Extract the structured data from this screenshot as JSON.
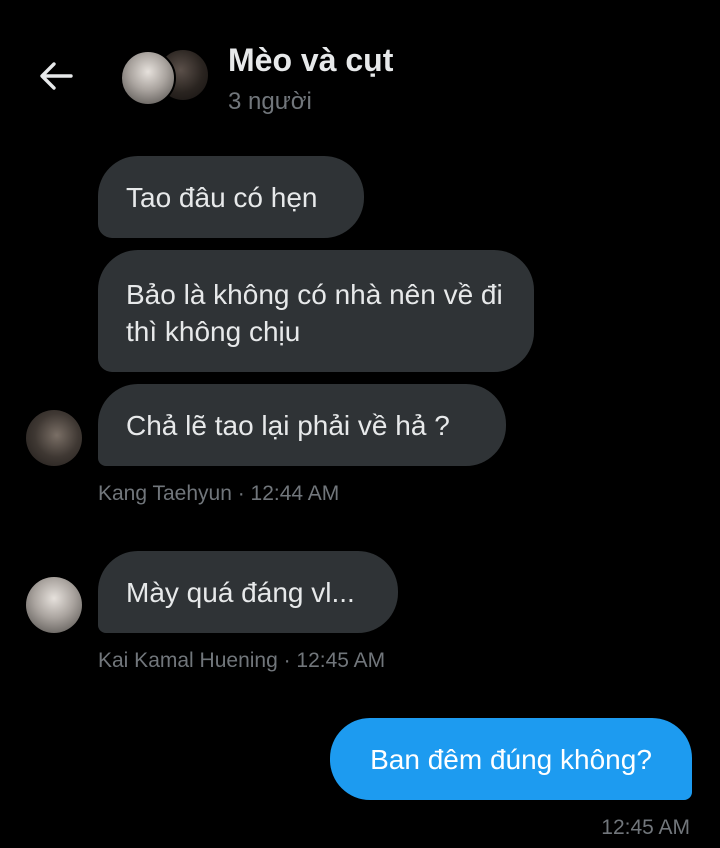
{
  "header": {
    "title": "Mèo và cụt",
    "subtitle": "3 người"
  },
  "messages": [
    {
      "text": "Tao đâu có hẹn",
      "direction": "incoming"
    },
    {
      "text": "Bảo là không có nhà nên về đi thì không chịu",
      "direction": "incoming"
    },
    {
      "text": "Chả lẽ tao lại phải về hả ?",
      "direction": "incoming"
    },
    {
      "text": "Mày quá đáng vl...",
      "direction": "incoming"
    },
    {
      "text": "Ban đêm đúng không?",
      "direction": "outgoing"
    }
  ],
  "meta": {
    "kang": "Kang Taehyun · 12:44 AM",
    "kai": "Kai Kamal Huening · 12:45 AM",
    "outgoing": "12:45 AM"
  },
  "colors": {
    "background": "#000000",
    "incoming_bubble": "#2f3336",
    "outgoing_bubble": "#1d9bf0",
    "secondary_text": "#71767b"
  }
}
